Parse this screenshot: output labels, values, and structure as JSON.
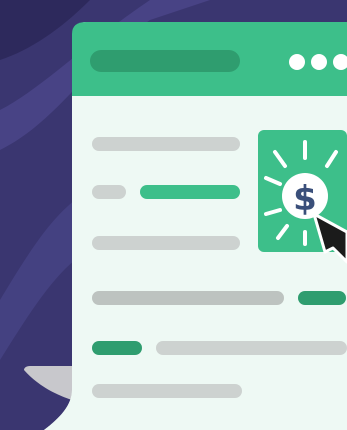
{
  "scene": {
    "colors": {
      "background": "#3a3670",
      "background_streak": "#5a55a0",
      "background_dark": "#24214f",
      "window_body": "#eef9f4",
      "window_header": "#3dbf8a",
      "header_bar": "#2f9d6f",
      "header_dots": "#ffffff",
      "placeholder_gray": "#cdd2d0",
      "placeholder_gray_dark": "#bdc3c0",
      "accent_green": "#3dbf8a",
      "accent_green_dark": "#2f9d6f",
      "paper_curl": "#c8c8cc",
      "cursor": "#1b1b1b"
    },
    "icon": {
      "name": "dollar-coin-icon",
      "symbol": "$"
    }
  }
}
